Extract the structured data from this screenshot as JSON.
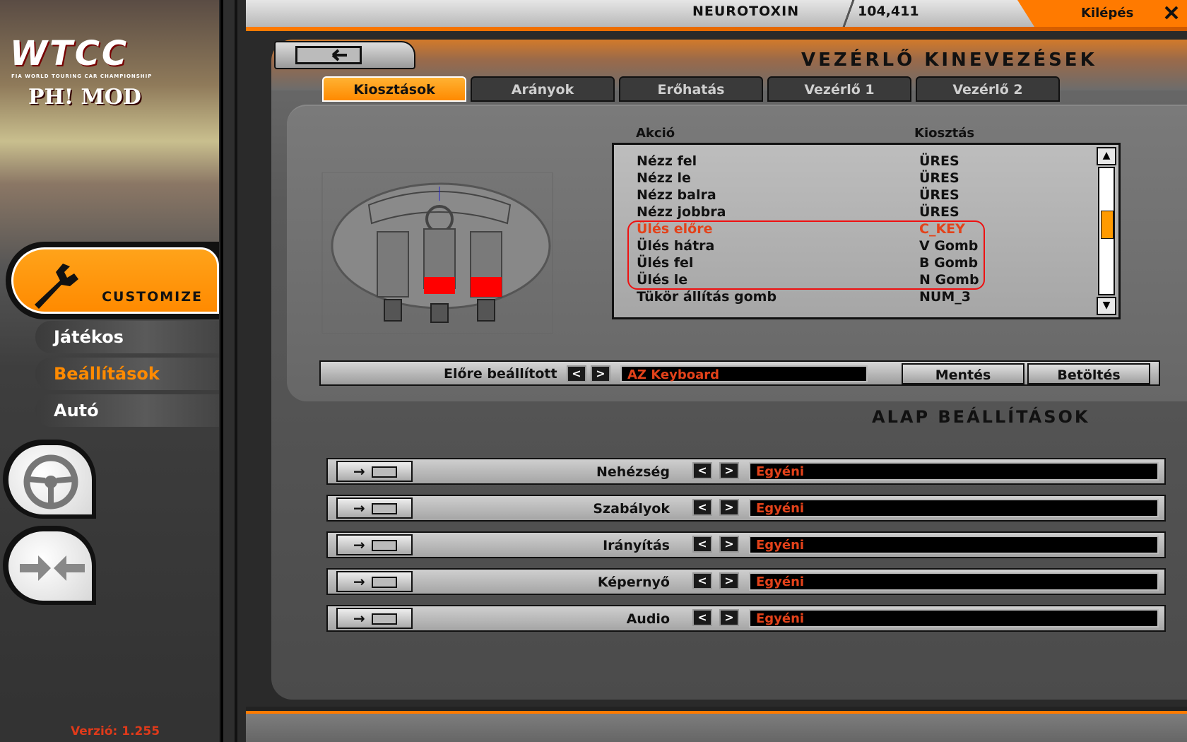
{
  "sidebar": {
    "logo_text": "WTCC",
    "logo_subtitle": "FIA WORLD TOURING CAR CHAMPIONSHIP",
    "logo_mod": "PH! MOD",
    "customize_label": "CUSTOMIZE",
    "items": [
      {
        "label": "Játékos",
        "active": false
      },
      {
        "label": "Beállítások",
        "active": true
      },
      {
        "label": "Autó",
        "active": false
      }
    ],
    "version": "Verzió: 1.255"
  },
  "topbar": {
    "user_name": "NEUROTOXIN",
    "score": "104,411",
    "exit_label": "Kilépés"
  },
  "page": {
    "title": "VEZÉRLŐ KINEVEZÉSEK",
    "tabs": [
      {
        "label": "Kiosztások",
        "active": true
      },
      {
        "label": "Arányok",
        "active": false
      },
      {
        "label": "Erőhatás",
        "active": false
      },
      {
        "label": "Vezérlő 1",
        "active": false
      },
      {
        "label": "Vezérlő 2",
        "active": false
      }
    ]
  },
  "assignments": {
    "header_action": "Akció",
    "header_key": "Kiosztás",
    "rows": [
      {
        "action": "Nézz fel",
        "key": "ÜRES",
        "selected": false
      },
      {
        "action": "Nézz le",
        "key": "ÜRES",
        "selected": false
      },
      {
        "action": "Nézz balra",
        "key": "ÜRES",
        "selected": false
      },
      {
        "action": "Nézz jobbra",
        "key": "ÜRES",
        "selected": false
      },
      {
        "action": "Ülés előre",
        "key": "C_KEY",
        "selected": true
      },
      {
        "action": "Ülés hátra",
        "key": "V Gomb",
        "selected": false
      },
      {
        "action": "Ülés fel",
        "key": "B Gomb",
        "selected": false
      },
      {
        "action": "Ülés le",
        "key": "N Gomb",
        "selected": false
      },
      {
        "action": "Tükör állítás gomb",
        "key": "NUM_3",
        "selected": false
      }
    ]
  },
  "preset": {
    "label": "Előre beállított",
    "value": "AZ Keyboard",
    "save_label": "Mentés",
    "load_label": "Betöltés"
  },
  "basic_settings": {
    "title": "ALAP BEÁLLÍTÁSOK",
    "rows": [
      {
        "label": "Nehézség",
        "value": "Egyéni"
      },
      {
        "label": "Szabályok",
        "value": "Egyéni"
      },
      {
        "label": "Irányítás",
        "value": "Egyéni"
      },
      {
        "label": "Képernyő",
        "value": "Egyéni"
      },
      {
        "label": "Audio",
        "value": "Egyéni"
      }
    ]
  },
  "colors": {
    "accent": "#ff8a00",
    "selected_text": "#e3421a",
    "panel": "#6a6a6a"
  },
  "icons": [
    "wrench-icon",
    "steering-wheel-icon",
    "arrows-in-icon",
    "close-icon",
    "back-arrow-icon",
    "scroll-up-icon",
    "scroll-down-icon"
  ]
}
